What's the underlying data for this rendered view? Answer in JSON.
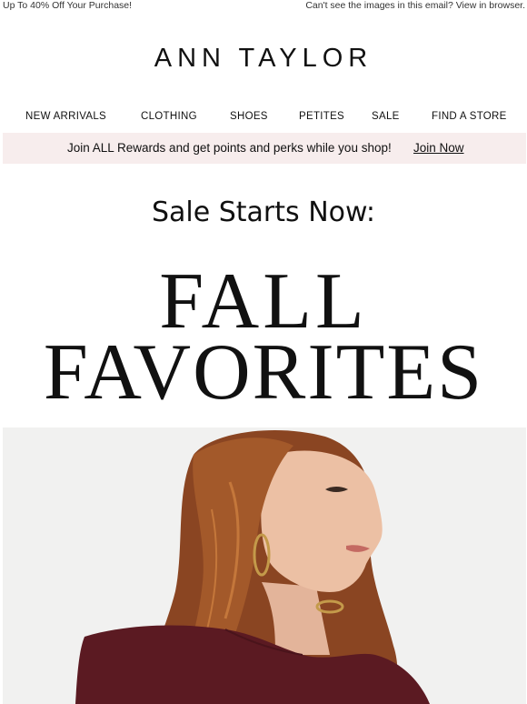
{
  "preheader": {
    "promo": "Up To 40% Off Your Purchase!",
    "view_in_browser": "Can't see the images in this email? View in browser."
  },
  "brand": {
    "logo_text": "ANN TAYLOR"
  },
  "nav": {
    "items": [
      "NEW ARRIVALS",
      "CLOTHING",
      "SHOES",
      "PETITES",
      "SALE",
      "FIND A STORE"
    ]
  },
  "rewards": {
    "message": "Join ALL Rewards and get points and perks while you shop!",
    "cta": "Join Now",
    "background_color": "#f7eded"
  },
  "hero": {
    "eyebrow": "Sale Starts Now:",
    "headline_line1": "FALL",
    "headline_line2": "FAVORITES",
    "image_alt": "Woman with auburn hair and gold hoop earring wearing a burgundy top"
  },
  "colors": {
    "text": "#111111",
    "garment": "#5b1a22",
    "hair": "#9a4e24"
  }
}
